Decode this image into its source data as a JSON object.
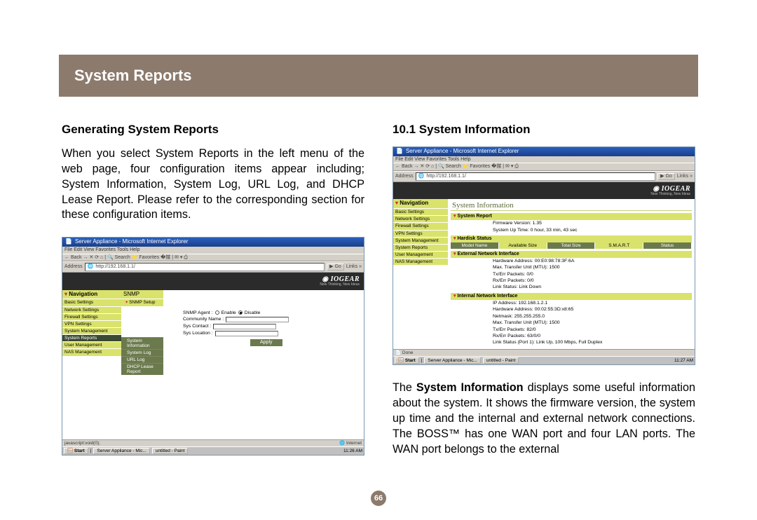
{
  "header": {
    "title": "System Reports"
  },
  "left": {
    "heading": "Generating System Reports",
    "para": "When you select System Reports in the left menu of the web page, four configuration items appear including; System Information, System Log, URL Log, and DHCP Lease Report. Please refer to the corresponding section for these configuration items."
  },
  "right": {
    "heading": "10.1 System Information",
    "para_prefix": "The ",
    "para_bold": "System Information",
    "para_suffix": " displays some useful information about the system. It shows the firmware version, the system up time and the internal and external network connections. The BOSS™ has one WAN port and four LAN ports. The WAN port belongs to the external"
  },
  "page_number": "66",
  "shot1": {
    "title": "Server Appliance - Microsoft Internet Explorer",
    "menu": "File   Edit   View   Favorites   Tools   Help",
    "toolbar": "← Back  →  ✕  ⟳  ⌂  | 🔍 Search  ⭐ Favorites  �媒  | ✉ ▾ ⎙",
    "addr_label": "Address",
    "addr_value": "http://192.168.1.1/",
    "go": "Go",
    "links": "Links »",
    "brand": "IOGEAR",
    "brand_sub": "New Thinking, New Ideas",
    "nav_title": "Navigation",
    "nav_items": [
      "Basic Settings",
      "Network Settings",
      "Firewall Settings",
      "VPN Settings",
      "System Management",
      "System Reports",
      "User Management",
      "NAS Management"
    ],
    "sub_items": [
      "System Information",
      "System Log",
      "URL Log",
      "DHCP Lease Report"
    ],
    "content_title": "SNMP",
    "snmp_setup": "SNMP Setup",
    "form": {
      "agent_label": "SNMP Agent :",
      "enable": "Enable",
      "disable": "Disable",
      "community": "Community Name :",
      "contact": "Sys Contact :",
      "location": "Sys Location :",
      "apply": "Apply"
    },
    "status_left": "javascript:void(0);",
    "status_right": "Internet",
    "task_start": "Start",
    "task_items": [
      "Server Appliance - Mic...",
      "untitled - Paint"
    ],
    "task_clock": "11:26 AM"
  },
  "shot2": {
    "title": "Server Appliance - Microsoft Internet Explorer",
    "menu": "File   Edit   View   Favorites   Tools   Help",
    "toolbar": "← Back  →  ✕  ⟳  ⌂  | 🔍 Search  ⭐ Favorites  �媒  | ✉ ▾ ⎙",
    "addr_label": "Address",
    "addr_value": "http://192.168.1.1/",
    "go": "Go",
    "links": "Links »",
    "brand": "IOGEAR",
    "brand_sub": "New Thinking, New Ideas",
    "nav_title": "Navigation",
    "nav_items": [
      "Basic Settings",
      "Network Settings",
      "Firewall Settings",
      "VPN Settings",
      "System Management",
      "System Reports",
      "User Management",
      "NAS Management"
    ],
    "content_title": "System Information",
    "sections": {
      "sysreport": "System Report",
      "firmware": "Firmware Version: 1.35",
      "uptime": "System Up Time: 0 hour, 33 min, 43 sec",
      "hdstatus": "Hardisk Status",
      "hd_headers": [
        "Model Name",
        "Available Size",
        "Total Size",
        "S.M.A.R.T",
        "Status"
      ],
      "ext": "External Network Interface",
      "ext_lines": [
        "Hardware Address: 00:E0:98:78:3F:6A",
        "Max. Transfer Unit (MTU): 1500",
        "Tx/Err Packets: 0/0",
        "Rx/Err Packets: 0/0",
        "Link Status: Link Down"
      ],
      "int": "Internal Network Interface",
      "int_lines": [
        "IP Address: 192.168.1.2.1",
        "Hardware Address: 00:02:55:3D:x8:65",
        "Netmask: 255.255.255.0",
        "Max. Transfer Unit (MTU): 1500",
        "Tx/Err Packets: 82/0",
        "Rx/Err Packets: 63/0/0",
        "Link Status (Port 1): Link Up, 100 Mbps, Full Duplex"
      ]
    },
    "status_left": "Done",
    "task_start": "Start",
    "task_items": [
      "Server Appliance - Mic...",
      "untitled - Paint"
    ],
    "task_clock": "11:27 AM"
  }
}
